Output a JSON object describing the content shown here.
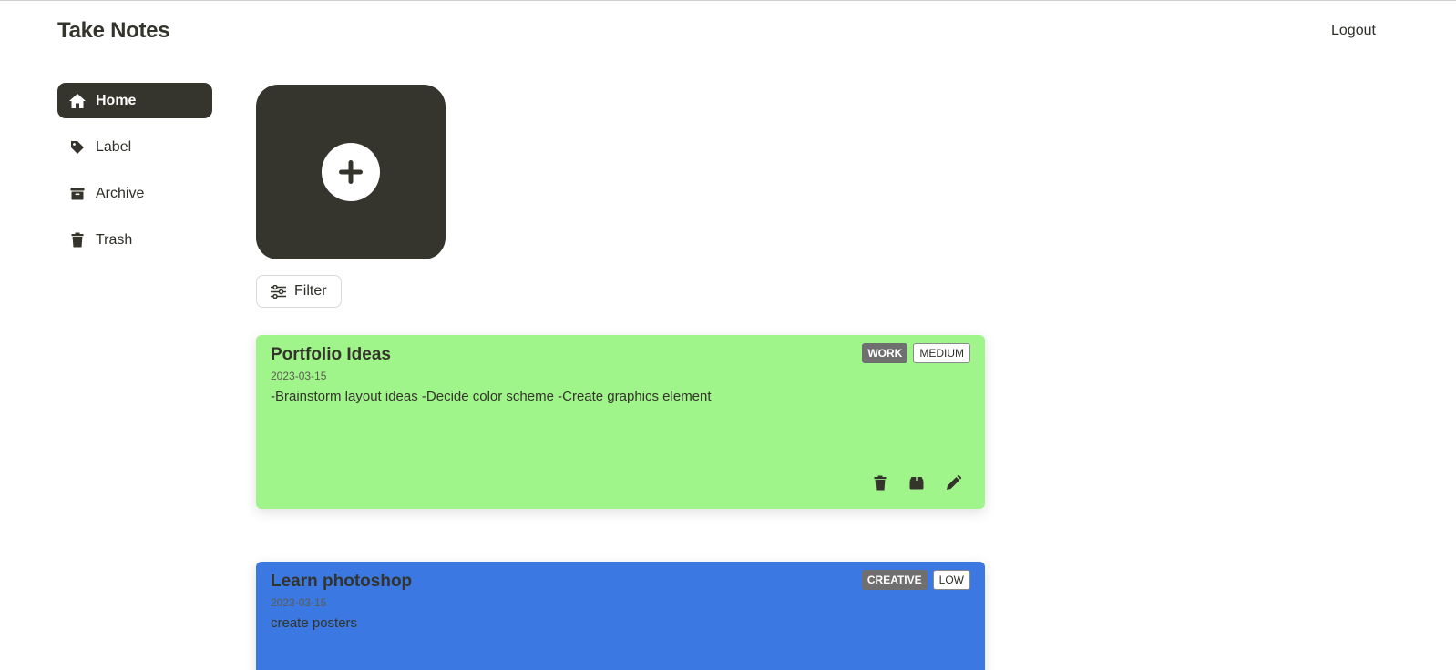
{
  "header": {
    "brand": "Take Notes",
    "logout_label": "Logout"
  },
  "sidebar": {
    "items": [
      {
        "label": "Home",
        "icon": "home-icon",
        "active": true
      },
      {
        "label": "Label",
        "icon": "tag-icon",
        "active": false
      },
      {
        "label": "Archive",
        "icon": "archive-icon",
        "active": false
      },
      {
        "label": "Trash",
        "icon": "trash-icon",
        "active": false
      }
    ]
  },
  "add_note": {
    "icon": "plus-icon"
  },
  "filter": {
    "label": "Filter",
    "icon": "sliders-icon"
  },
  "notes": [
    {
      "title": "Portfolio Ideas",
      "date": "2023-03-15",
      "body": "-Brainstorm layout ideas -Decide color scheme -Create graphics element",
      "category": "WORK",
      "priority": "MEDIUM",
      "color": "#9ff58a"
    },
    {
      "title": "Learn photoshop",
      "date": "2023-03-15",
      "body": "create posters",
      "category": "CREATIVE",
      "priority": "LOW",
      "color": "#3b78e2"
    }
  ],
  "colors": {
    "dark": "#35352d",
    "tag_gray": "#6f6f6f"
  }
}
